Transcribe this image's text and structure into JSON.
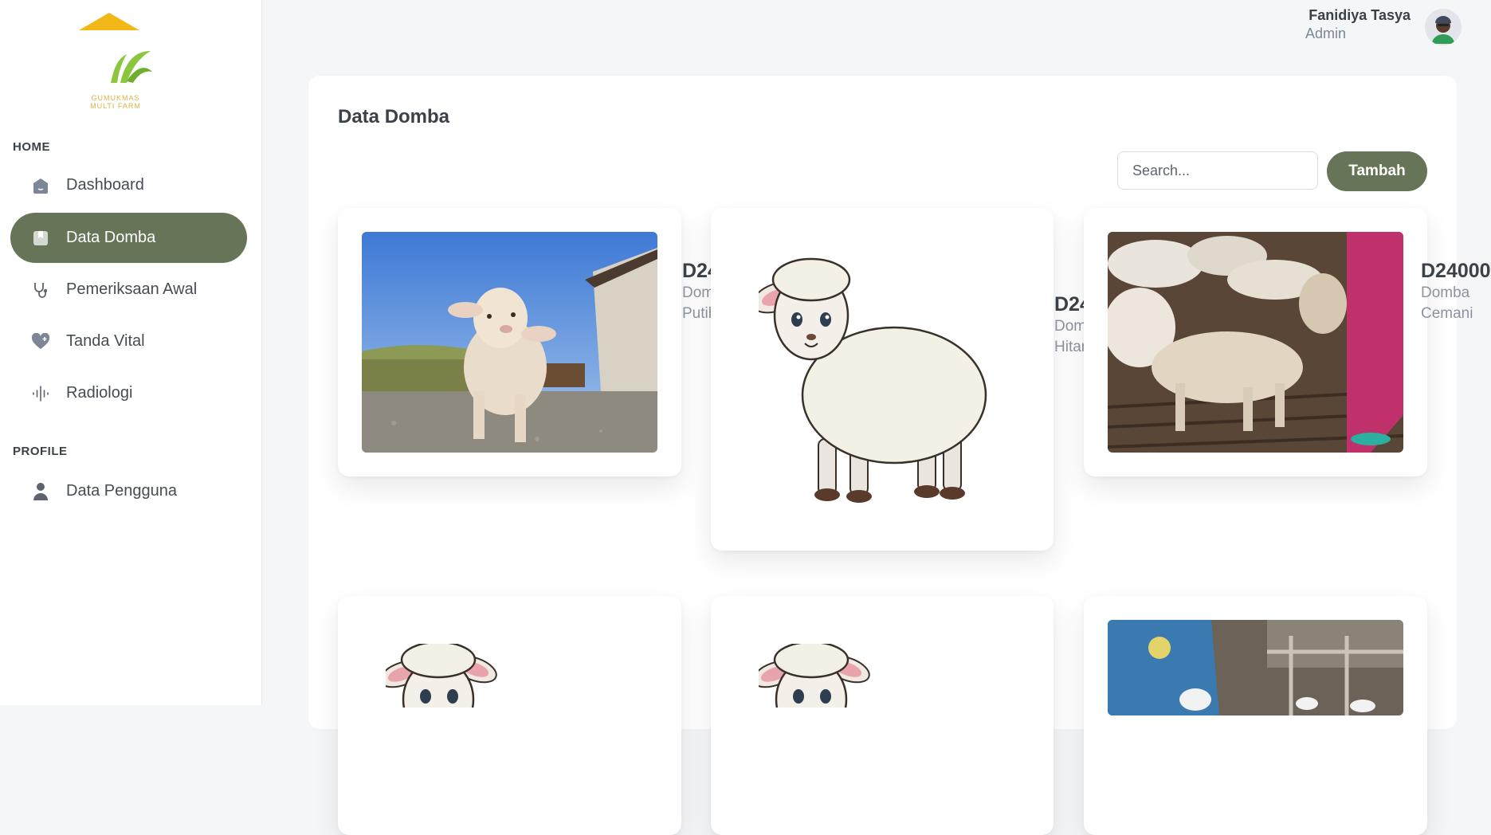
{
  "brand": {
    "logo_line1": "GUMUKMAS",
    "logo_line2": "MULTI FARM"
  },
  "sidebar": {
    "home_label": "HOME",
    "profile_label": "PROFILE",
    "items": [
      {
        "label": "Dashboard",
        "icon": "home-icon",
        "active": false
      },
      {
        "label": "Data Domba",
        "icon": "bookmark-icon",
        "active": true
      },
      {
        "label": "Pemeriksaan Awal",
        "icon": "stethoscope-icon",
        "active": false
      },
      {
        "label": "Tanda Vital",
        "icon": "heart-plus-icon",
        "active": false
      },
      {
        "label": "Radiologi",
        "icon": "soundwave-icon",
        "active": false
      },
      {
        "label": "Data Pengguna",
        "icon": "user-icon",
        "active": false
      }
    ]
  },
  "header": {
    "user_name": "Fanidiya Tasya",
    "user_role": "Admin",
    "avatar_icon": "avatar-icon"
  },
  "main": {
    "title": "Data Domba",
    "search": {
      "placeholder": "Search...",
      "value": ""
    },
    "add_label": "Tambah",
    "cards": [
      {
        "id": "D24",
        "type": "Domba Putih",
        "image": "lamb-photo"
      },
      {
        "id": "D24",
        "type": "Domba Hitam",
        "image": "sheep-illustration"
      },
      {
        "id": "D24000",
        "type": "Domba Cemani",
        "image": "sheep-pen-photo"
      },
      {
        "id": "",
        "type": "",
        "image": "sheep-illustration"
      },
      {
        "id": "",
        "type": "",
        "image": "sheep-illustration"
      },
      {
        "id": "",
        "type": "",
        "image": "barn-photo"
      }
    ]
  },
  "colors": {
    "accent": "#667458",
    "logo_yellow": "#f2b818",
    "logo_green": "#8cc63f",
    "background": "#f5f6f8"
  }
}
